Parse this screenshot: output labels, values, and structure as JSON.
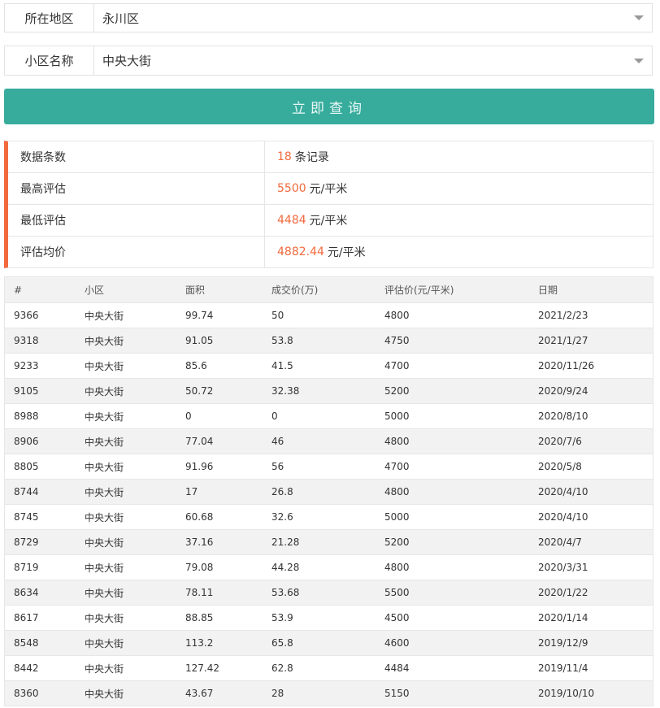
{
  "filters": {
    "district": {
      "label": "所在地区",
      "value": "永川区"
    },
    "community": {
      "label": "小区名称",
      "value": "中央大街"
    }
  },
  "query_button": {
    "label": "立即查询"
  },
  "summary": {
    "count": {
      "label": "数据条数",
      "number": "18",
      "unit": "条记录"
    },
    "max": {
      "label": "最高评估",
      "number": "5500",
      "unit": "元/平米"
    },
    "min": {
      "label": "最低评估",
      "number": "4484",
      "unit": "元/平米"
    },
    "avg": {
      "label": "评估均价",
      "number": "4882.44",
      "unit": "元/平米"
    }
  },
  "colors": {
    "accent": "#37ac9d",
    "highlight": "#f26a3d"
  },
  "table": {
    "headers": [
      "#",
      "小区",
      "面积",
      "成交价(万)",
      "评估价(元/平米)",
      "日期"
    ],
    "rows": [
      [
        "9366",
        "中央大街",
        "99.74",
        "50",
        "4800",
        "2021/2/23"
      ],
      [
        "9318",
        "中央大街",
        "91.05",
        "53.8",
        "4750",
        "2021/1/27"
      ],
      [
        "9233",
        "中央大街",
        "85.6",
        "41.5",
        "4700",
        "2020/11/26"
      ],
      [
        "9105",
        "中央大街",
        "50.72",
        "32.38",
        "5200",
        "2020/9/24"
      ],
      [
        "8988",
        "中央大街",
        "0",
        "0",
        "5000",
        "2020/8/10"
      ],
      [
        "8906",
        "中央大街",
        "77.04",
        "46",
        "4800",
        "2020/7/6"
      ],
      [
        "8805",
        "中央大街",
        "91.96",
        "56",
        "4700",
        "2020/5/8"
      ],
      [
        "8744",
        "中央大街",
        "17",
        "26.8",
        "4800",
        "2020/4/10"
      ],
      [
        "8745",
        "中央大街",
        "60.68",
        "32.6",
        "5000",
        "2020/4/10"
      ],
      [
        "8729",
        "中央大街",
        "37.16",
        "21.28",
        "5200",
        "2020/4/7"
      ],
      [
        "8719",
        "中央大街",
        "79.08",
        "44.28",
        "4800",
        "2020/3/31"
      ],
      [
        "8634",
        "中央大街",
        "78.11",
        "53.68",
        "5500",
        "2020/1/22"
      ],
      [
        "8617",
        "中央大街",
        "88.85",
        "53.9",
        "4500",
        "2020/1/14"
      ],
      [
        "8548",
        "中央大街",
        "113.2",
        "65.8",
        "4600",
        "2019/12/9"
      ],
      [
        "8442",
        "中央大街",
        "127.42",
        "62.8",
        "4484",
        "2019/11/4"
      ],
      [
        "8360",
        "中央大街",
        "43.67",
        "28",
        "5150",
        "2019/10/10"
      ]
    ]
  }
}
